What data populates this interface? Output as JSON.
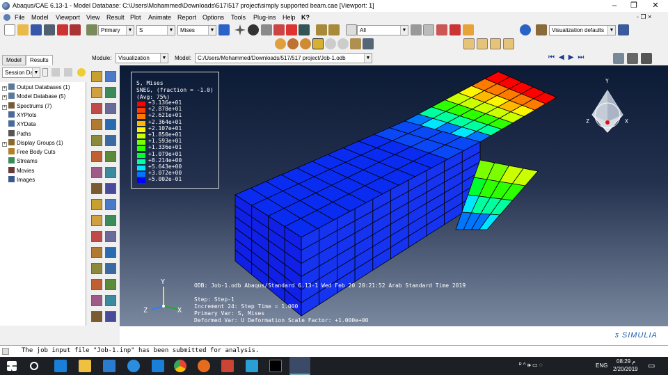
{
  "window": {
    "title": "Abaqus/CAE 6.13-1 - Model Database: C:\\Users\\Mohammed\\Downloads\\517\\517 project\\simply supported beam.cae [Viewport: 1]",
    "minimize": "–",
    "maximize": "❐",
    "close": "✕"
  },
  "menu": {
    "items": [
      "File",
      "Model",
      "Viewport",
      "View",
      "Result",
      "Plot",
      "Animate",
      "Report",
      "Options",
      "Tools",
      "Plug-ins",
      "Help",
      "K?"
    ],
    "mdi_restore": "‑ ❐ ×"
  },
  "toolbar": {
    "step_select": "Primary",
    "variable_select": "S",
    "invariant_select": "Mises",
    "selection_filter": "All",
    "view_manager": "Visualization defaults"
  },
  "tabs": {
    "model": "Model",
    "results": "Results"
  },
  "context": {
    "module_label": "Module:",
    "module_value": "Visualization",
    "model_label": "Model:",
    "model_value": "C:/Users/Mohammed/Downloads/517/517 project/Job-1.odb"
  },
  "session": {
    "label": "Session Dat"
  },
  "tree": [
    {
      "label": "Output Databases (1)",
      "icon": "database-icon",
      "expand": true
    },
    {
      "label": "Model Database (5)",
      "icon": "database-icon",
      "expand": true
    },
    {
      "label": "Spectrums (7)",
      "icon": "spectrum-icon",
      "expand": true
    },
    {
      "label": "XYPlots",
      "icon": "xyplot-icon",
      "expand": false
    },
    {
      "label": "XYData",
      "icon": "xydata-icon",
      "expand": false
    },
    {
      "label": "Paths",
      "icon": "path-icon",
      "expand": false
    },
    {
      "label": "Display Groups (1)",
      "icon": "display-group-icon",
      "expand": true
    },
    {
      "label": "Free Body Cuts",
      "icon": "free-body-icon",
      "expand": false
    },
    {
      "label": "Streams",
      "icon": "stream-icon",
      "expand": false
    },
    {
      "label": "Movies",
      "icon": "movie-icon",
      "expand": false
    },
    {
      "label": "Images",
      "icon": "image-icon",
      "expand": false
    }
  ],
  "legend": {
    "line1": "S, Mises",
    "line2": "SNEG, (fraction = -1.0)",
    "line3": "(Avg: 75%)",
    "levels": [
      {
        "value": "+3.136e+01",
        "color": "#ff0000"
      },
      {
        "value": "+2.878e+01",
        "color": "#ff3d00"
      },
      {
        "value": "+2.621e+01",
        "color": "#ff7b00"
      },
      {
        "value": "+2.364e+01",
        "color": "#ffb800"
      },
      {
        "value": "+2.107e+01",
        "color": "#fff500"
      },
      {
        "value": "+1.850e+01",
        "color": "#c9ff00"
      },
      {
        "value": "+1.593e+01",
        "color": "#7bff00"
      },
      {
        "value": "+1.336e+01",
        "color": "#2eff00"
      },
      {
        "value": "+1.079e+01",
        "color": "#00ff2e"
      },
      {
        "value": "+8.214e+00",
        "color": "#00ff9e"
      },
      {
        "value": "+5.643e+00",
        "color": "#00e6ff"
      },
      {
        "value": "+3.072e+00",
        "color": "#0076ff"
      },
      {
        "value": "+5.002e-01",
        "color": "#0000ff"
      }
    ]
  },
  "viewport_info": {
    "odb": "ODB: Job-1.odb    Abaqus/Standard 6.13-1    Wed Feb 20 20:21:52 Arab Standard Time 2019",
    "step": "Step: Step-1",
    "increment": "Increment    24: Step Time =    1.000",
    "primary_var": "Primary Var: S, Mises",
    "deformed_var": "Deformed Var: U   Deformation Scale Factor: +1.000e+00"
  },
  "triad": {
    "x": "X",
    "y": "Y",
    "z": "Z"
  },
  "view_cube": {
    "x": "X",
    "y": "Y",
    "z": "Z"
  },
  "brand": "SIMULIA",
  "message": {
    "line": "The job input file \"Job-1.inp\" has been submitted for analysis."
  },
  "taskbar": {
    "language": "ENG",
    "time": "08:29 م",
    "date": "2/20/2019"
  }
}
